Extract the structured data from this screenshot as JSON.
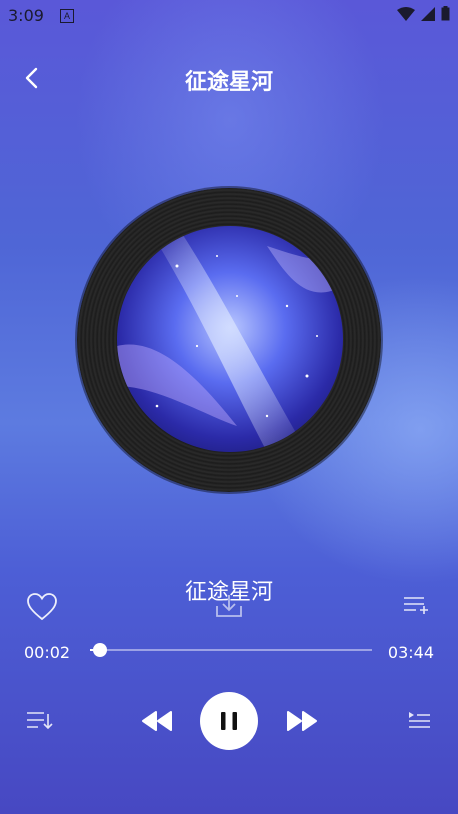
{
  "status_bar": {
    "time": "3:09",
    "indicator": "A"
  },
  "header": {
    "title": "征途星河",
    "back_icon": "chevron-left-icon"
  },
  "player": {
    "song_title": "征途星河",
    "current_time": "00:02",
    "total_time": "03:44",
    "progress": 0.009
  },
  "colors": {
    "accent": "#ffffff",
    "disc": "#1e1e1e",
    "background": "#5467d8"
  }
}
